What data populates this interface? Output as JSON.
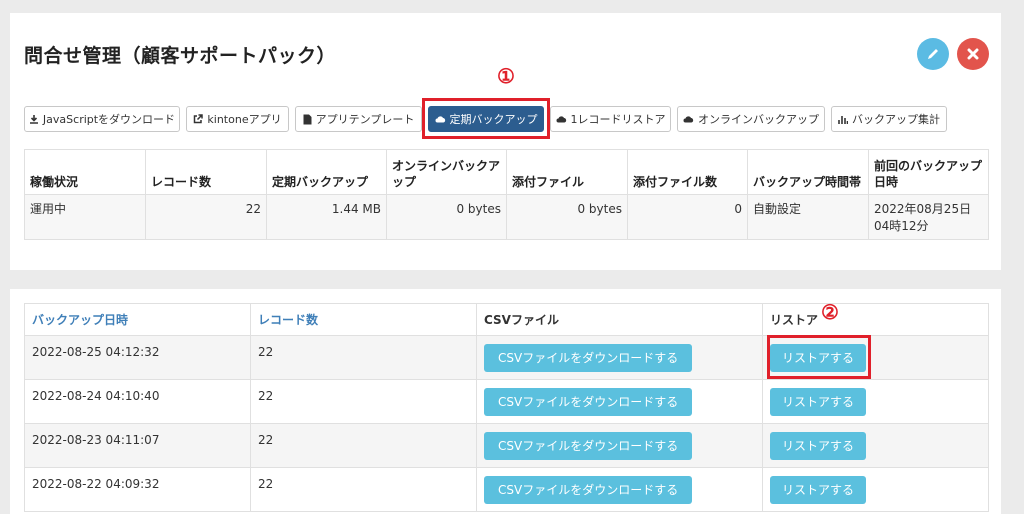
{
  "header": {
    "title": "問合せ管理（顧客サポートパック）"
  },
  "markers": {
    "one": "①",
    "two": "②"
  },
  "toolbar": {
    "buttons": [
      {
        "label": "JavaScriptをダウンロード",
        "icon": "download-icon"
      },
      {
        "label": "kintoneアプリ",
        "icon": "external-link-icon"
      },
      {
        "label": "アプリテンプレート",
        "icon": "file-icon"
      },
      {
        "label": "定期バックアップ",
        "icon": "cloud-icon",
        "active": true
      },
      {
        "label": "1レコードリストア",
        "icon": "cloud-icon"
      },
      {
        "label": "オンラインバックアップ",
        "icon": "cloud-icon"
      },
      {
        "label": "バックアップ集計",
        "icon": "bar-chart-icon"
      }
    ]
  },
  "summary": {
    "headers": [
      "稼働状況",
      "レコード数",
      "定期バックアップ",
      "オンラインバックアップ",
      "添付ファイル",
      "添付ファイル数",
      "バックアップ時間帯",
      "前回のバックアップ日時"
    ],
    "row": [
      "運用中",
      "22",
      "1.44 MB",
      "0 bytes",
      "0 bytes",
      "0",
      "自動設定",
      "2022年08月25日04時12分"
    ]
  },
  "backups": {
    "headers": [
      "バックアップ日時",
      "レコード数",
      "CSVファイル",
      "リストア"
    ],
    "csv_button": "CSVファイルをダウンロードする",
    "restore_button": "リストアする",
    "rows": [
      {
        "date": "2022-08-25 04:12:32",
        "records": "22"
      },
      {
        "date": "2022-08-24 04:10:40",
        "records": "22"
      },
      {
        "date": "2022-08-23 04:11:07",
        "records": "22"
      },
      {
        "date": "2022-08-22 04:09:32",
        "records": "22"
      }
    ]
  },
  "colors": {
    "accent": "#2c5d8f",
    "info": "#5bc0de",
    "danger": "#e2544c",
    "annotation": "#e0202a"
  }
}
